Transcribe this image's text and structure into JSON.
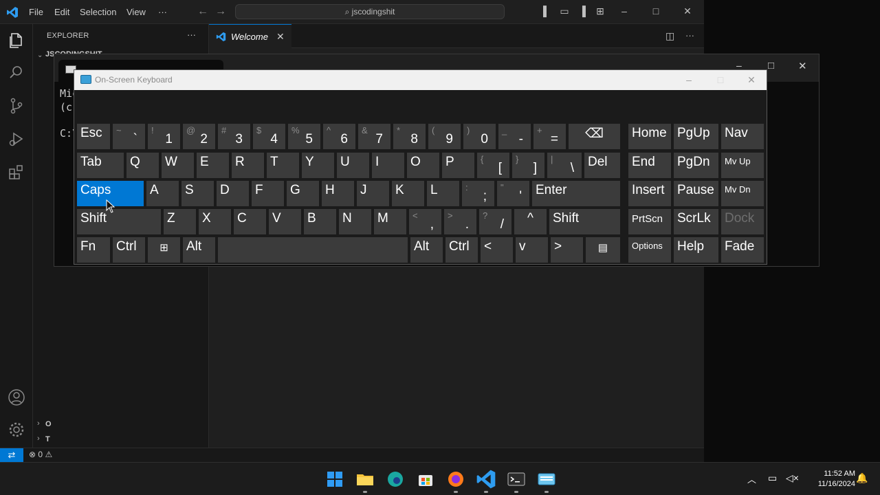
{
  "vscode": {
    "menu": [
      "File",
      "Edit",
      "Selection",
      "View",
      "···"
    ],
    "command_center": "jscodingshit",
    "sidebar_title": "EXPLORER",
    "sidebar_more": "···",
    "folder_label": "JSCODINGSHIT",
    "outline_short": "O",
    "timeline_short": "T",
    "tab_label": "Welcome",
    "status_problems": "0",
    "status_warnings": "0"
  },
  "terminal": {
    "lines": [
      "Mic",
      "(c)",
      "",
      "C:\\"
    ]
  },
  "osk": {
    "title": "On-Screen Keyboard",
    "row1": [
      {
        "label": "Esc"
      },
      {
        "shift": "~",
        "main": "`"
      },
      {
        "shift": "!",
        "main": "1"
      },
      {
        "shift": "@",
        "main": "2"
      },
      {
        "shift": "#",
        "main": "3"
      },
      {
        "shift": "$",
        "main": "4"
      },
      {
        "shift": "%",
        "main": "5"
      },
      {
        "shift": "^",
        "main": "6"
      },
      {
        "shift": "&",
        "main": "7"
      },
      {
        "shift": "*",
        "main": "8"
      },
      {
        "shift": "(",
        "main": "9"
      },
      {
        "shift": ")",
        "main": "0"
      },
      {
        "shift": "_",
        "main": "-"
      },
      {
        "shift": "+",
        "main": "="
      },
      {
        "label": "⌫"
      }
    ],
    "row2": [
      "Tab",
      "Q",
      "W",
      "E",
      "R",
      "T",
      "Y",
      "U",
      "I",
      "O",
      "P",
      {
        "shift": "{",
        "main": "["
      },
      {
        "shift": "}",
        "main": "]"
      },
      {
        "shift": "|",
        "main": "\\"
      },
      "Del"
    ],
    "row3": [
      "Caps",
      "A",
      "S",
      "D",
      "F",
      "G",
      "H",
      "J",
      "K",
      "L",
      {
        "shift": ":",
        "main": ";"
      },
      {
        "shift": "\"",
        "main": "'"
      },
      "Enter"
    ],
    "row4": [
      "Shift",
      "Z",
      "X",
      "C",
      "V",
      "B",
      "N",
      "M",
      {
        "shift": "<",
        "main": ","
      },
      {
        "shift": ">",
        "main": "."
      },
      {
        "shift": "?",
        "main": "/"
      },
      "^",
      "Shift"
    ],
    "row5": [
      "Fn",
      "Ctrl",
      "⊞",
      "Alt",
      "",
      "Alt",
      "Ctrl",
      "<",
      "v",
      ">",
      "▤"
    ],
    "nav": [
      [
        "Home",
        "PgUp",
        "Nav"
      ],
      [
        "End",
        "PgDn",
        "Mv Up"
      ],
      [
        "Insert",
        "Pause",
        "Mv Dn"
      ],
      [
        "PrtScn",
        "ScrLk",
        "Dock"
      ],
      [
        "Options",
        "Help",
        "Fade"
      ]
    ]
  },
  "taskbar": {
    "time": "11:52 AM",
    "date": "11/16/2024",
    "colors": {
      "accent": "#0078d4",
      "caps_active": "#0078d4"
    }
  }
}
